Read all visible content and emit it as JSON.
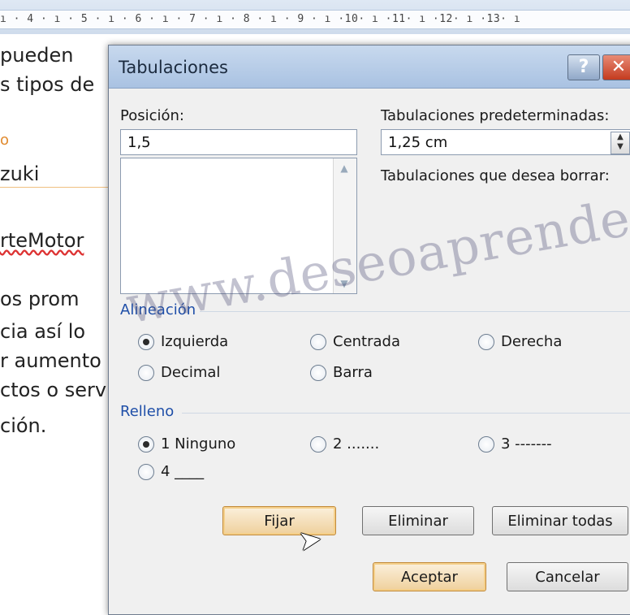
{
  "ruler": {
    "ticks": "ı · 4 · ı · 5 · ı · 6 · ı · 7 · ı · 8 · ı · 9 · ı ·10· ı ·11· ı ·12· ı ·13· ı"
  },
  "document": {
    "lines": [
      "pueden",
      "s tipos de",
      "o",
      "zuki",
      "rteMotor",
      "os prom",
      "cia  así  lo",
      "r  aumento",
      "ctos o serv",
      "ción."
    ]
  },
  "dialog": {
    "title": "Tabulaciones",
    "help_label": "?",
    "close_label": "✕",
    "position_label": "Posición:",
    "position_value": "1,5",
    "default_tabs_label": "Tabulaciones predeterminadas:",
    "default_tabs_value": "1,25 cm",
    "tabs_to_clear_label": "Tabulaciones que desea borrar:",
    "alignment": {
      "group_label": "Alineación",
      "options": [
        "Izquierda",
        "Centrada",
        "Derecha",
        "Decimal",
        "Barra"
      ],
      "selected": "Izquierda"
    },
    "leader": {
      "group_label": "Relleno",
      "options": [
        "1 Ninguno",
        "2 .......",
        "3 -------",
        "4 ____"
      ],
      "selected": "1 Ninguno"
    },
    "buttons": {
      "set": "Fijar",
      "clear": "Eliminar",
      "clear_all": "Eliminar todas",
      "ok": "Aceptar",
      "cancel": "Cancelar"
    }
  },
  "watermark": "www.deseoaprender.com",
  "colors": {
    "titlebar": "#a9c2e2",
    "group_label": "#1f4fa8",
    "close_button": "#c43b1f",
    "focus_button": "#f4cf8a"
  }
}
